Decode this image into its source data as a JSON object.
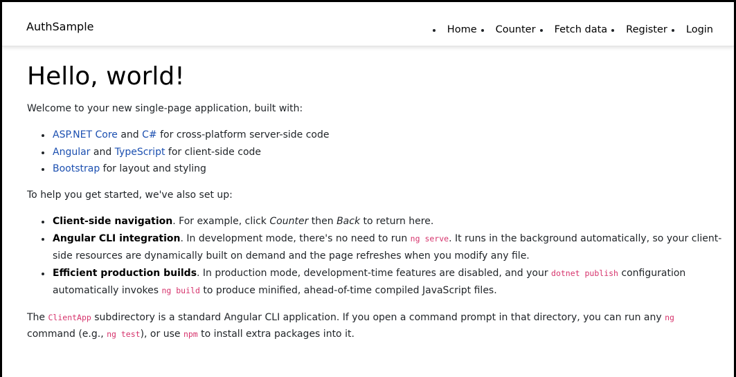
{
  "navbar": {
    "brand": "AuthSample",
    "links": [
      "Home",
      "Counter",
      "Fetch data",
      "Register",
      "Login"
    ]
  },
  "main": {
    "title": "Hello, world!",
    "intro": "Welcome to your new single-page application, built with:",
    "tech_list": [
      {
        "link1": "ASP.NET Core",
        "text1": " and ",
        "link2": "C#",
        "text2": " for cross-platform server-side code"
      },
      {
        "link1": "Angular",
        "text1": " and ",
        "link2": "TypeScript",
        "text2": " for client-side code"
      },
      {
        "link1": "Bootstrap",
        "text1": " for layout and styling"
      }
    ],
    "help_intro": "To help you get started, we've also set up:",
    "features": [
      {
        "title": "Client-side navigation",
        "t1": ". For example, click ",
        "em1": "Counter",
        "t2": " then ",
        "em2": "Back",
        "t3": " to return here."
      },
      {
        "title": "Angular CLI integration",
        "t1": ". In development mode, there's no need to run ",
        "code1": "ng serve",
        "t2": ". It runs in the background automatically, so your client-side resources are dynamically built on demand and the page refreshes when you modify any file."
      },
      {
        "title": "Efficient production builds",
        "t1": ". In production mode, development-time features are disabled, and your ",
        "code1": "dotnet publish",
        "t2": " configuration automatically invokes ",
        "code2": "ng build",
        "t3": " to produce minified, ahead-of-time compiled JavaScript files."
      }
    ],
    "clientapp": {
      "t0": "The ",
      "code1": "ClientApp",
      "t1": " subdirectory is a standard Angular CLI application. If you open a command prompt in that directory, you can run any ",
      "code2": "ng",
      "t2": " command (e.g., ",
      "code3": "ng test",
      "t3": "), or use ",
      "code4": "npm",
      "t4": " to install extra packages into it."
    }
  }
}
